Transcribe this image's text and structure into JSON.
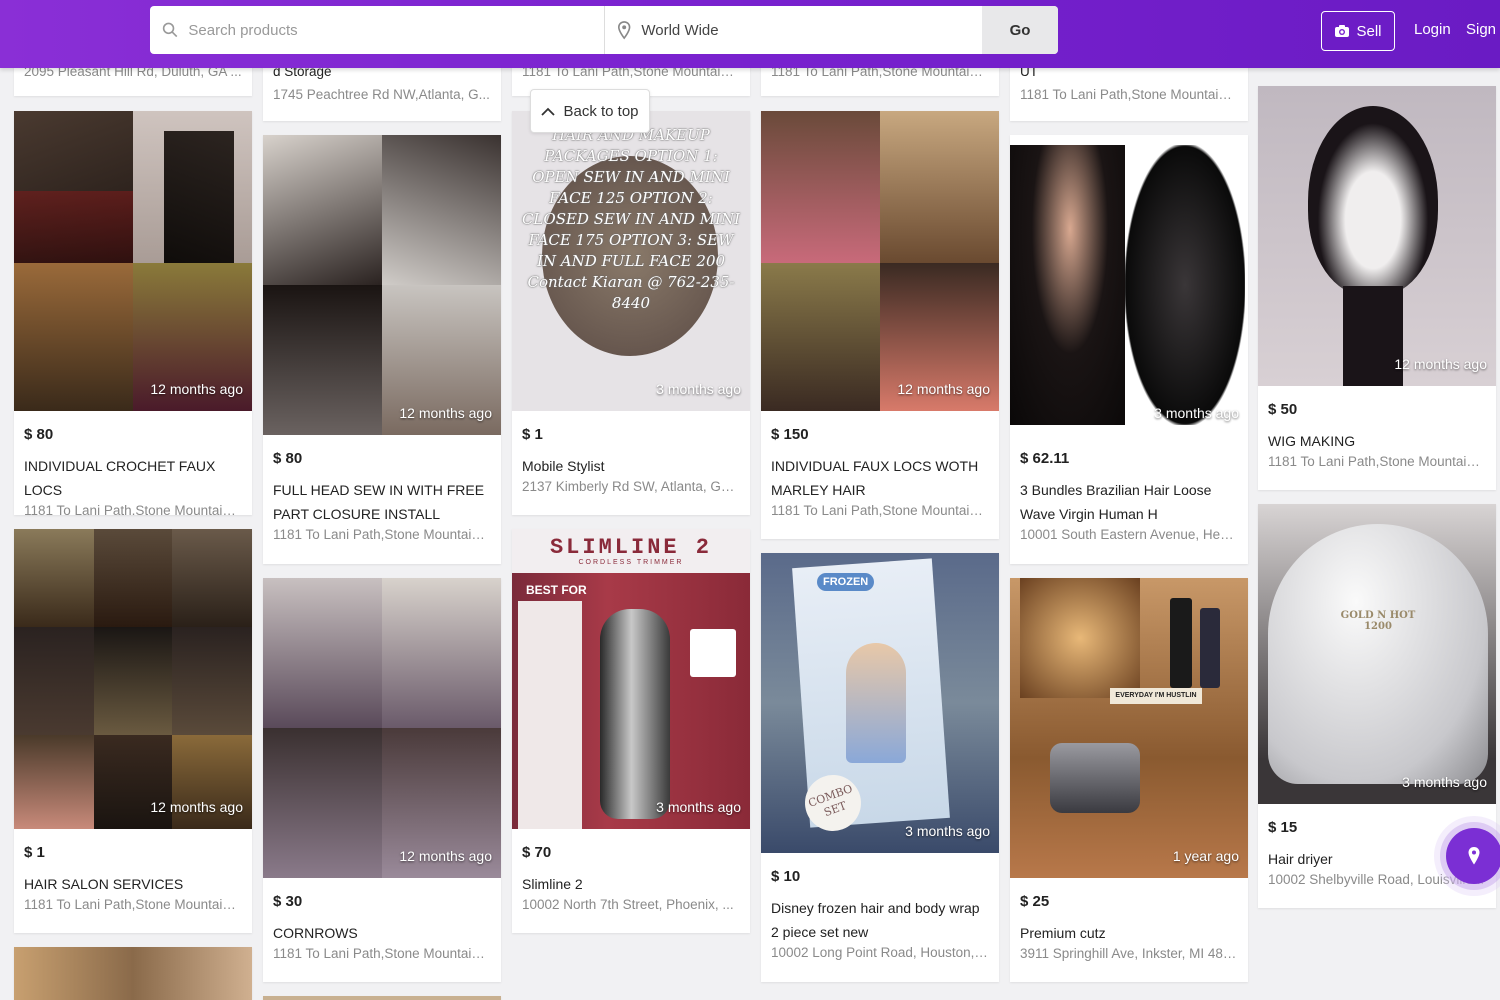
{
  "header": {
    "search_placeholder": "Search products",
    "location_value": "World Wide",
    "go_label": "Go",
    "sell_label": "Sell",
    "login_label": "Login",
    "signup_label": "Sign up"
  },
  "back_to_top": "Back to top",
  "partial_top": {
    "col1_loc": "2095 Pleasant Hill Rd, Duluth, GA ...",
    "col2_title": "d Storage",
    "col2_loc": "1745 Peachtree Rd NW,Atlanta, G...",
    "col3_loc": "1181 To Lani Path,Stone Mountain, ...",
    "col4_loc": "1181 To Lani Path,Stone Mountain, ...",
    "col5_title": "UT",
    "col5_loc": "1181 To Lani Path,Stone Mountain, ..."
  },
  "listings": [
    {
      "price": "$ 80",
      "title": "INDIVIDUAL CROCHET FAUX LOCS",
      "loc": "1181 To Lani Path,Stone Mountain, ...",
      "ago": "12 months ago"
    },
    {
      "price": "$ 80",
      "title": "FULL HEAD SEW IN WITH FREE PART CLOSURE INSTALL",
      "loc": "1181 To Lani Path,Stone Mountain, ...",
      "ago": "12 months ago"
    },
    {
      "price": "$ 1",
      "title": "Mobile Stylist",
      "loc": "2137 Kimberly Rd SW, Atlanta, GA ...",
      "ago": "3 months ago"
    },
    {
      "price": "$ 150",
      "title": "INDIVIDUAL FAUX LOCS WOTH MARLEY HAIR",
      "loc": "1181 To Lani Path,Stone Mountain, ...",
      "ago": "12 months ago"
    },
    {
      "price": "$ 62.11",
      "title": "3 Bundles Brazilian Hair Loose Wave Virgin Human H",
      "loc": "10001 South Eastern Avenue, Hen...",
      "ago": "3 months ago"
    },
    {
      "price": "$ 50",
      "title": "WIG MAKING",
      "loc": "1181 To Lani Path,Stone Mountain, ...",
      "ago": "12 months ago"
    },
    {
      "price": "$ 1",
      "title": "HAIR SALON SERVICES",
      "loc": "1181 To Lani Path,Stone Mountain, ...",
      "ago": "12 months ago"
    },
    {
      "price": "$ 30",
      "title": "CORNROWS",
      "loc": "1181 To Lani Path,Stone Mountain, ...",
      "ago": "12 months ago"
    },
    {
      "price": "$ 70",
      "title": "Slimline 2",
      "loc": "10002 North 7th Street, Phoenix, ...",
      "ago": "3 months ago"
    },
    {
      "price": "$ 10",
      "title": "Disney frozen hair and body wrap 2 piece set new",
      "loc": "10002 Long Point Road, Houston, ...",
      "ago": "3 months ago"
    },
    {
      "price": "$ 25",
      "title": "Premium cutz",
      "loc": "3911 Springhill Ave, Inkster, MI 481...",
      "ago": "1 year ago"
    },
    {
      "price": "$ 15",
      "title": "Hair driyer",
      "loc": "10002 Shelbyville Road, Louisville...",
      "ago": "3 months ago"
    }
  ],
  "image_text": {
    "mobile_stylist": "HAIR AND MAKEUP PACKAGES OPTION 1: OPEN SEW IN AND MINI FACE 125 OPTION 2: CLOSED SEW IN AND MINI FACE 175 OPTION 3: SEW IN AND FULL FACE 200 Contact Kiaran @ 762-235-8440",
    "slimline_brand": "SLIMLINE 2",
    "slimline_sub": "CORDLESS TRIMMER",
    "slimline_best": "BEST FOR",
    "dryer_brand": "GOLD N HOT 1200",
    "frozen_label": "FROZEN",
    "combo_label": "COMBO SET",
    "hustlin_label": "EVERYDAY I'M HUSTLIN"
  },
  "colors": {
    "header_purple": "#7a22cf",
    "fab_purple": "#7b2fd4",
    "card_bg": "#ffffff"
  }
}
